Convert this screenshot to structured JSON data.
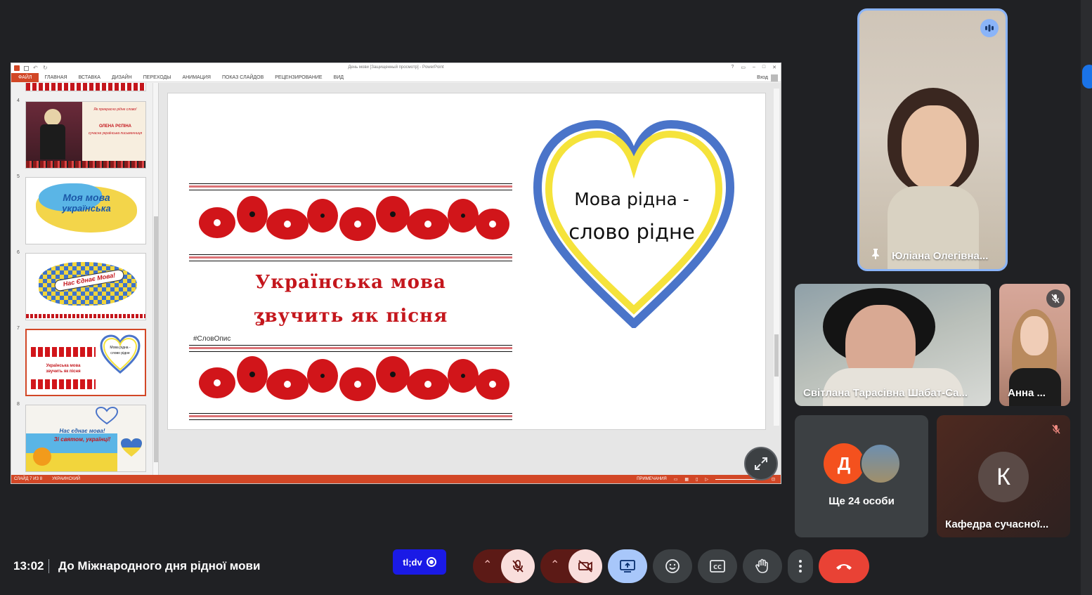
{
  "ppt": {
    "window_title": "День мови [Защищенный просмотр] - PowerPoint",
    "tabs": [
      "ФАЙЛ",
      "ГЛАВНАЯ",
      "ВСТАВКА",
      "ДИЗАЙН",
      "ПЕРЕХОДЫ",
      "АНИМАЦИЯ",
      "ПОКАЗ СЛАЙДОВ",
      "РЕЦЕНЗИРОВАНИЕ",
      "ВИД"
    ],
    "signin": "Вход",
    "thumbnails": [
      {
        "num": "4",
        "lines": [
          "Як прекрасно рідне слово!",
          "ОЛЕНА РЄПІНА",
          "сучасна українська письменниця"
        ]
      },
      {
        "num": "5",
        "lines": [
          "Моя мова",
          "українська"
        ]
      },
      {
        "num": "6",
        "lines": [
          "Нас Єднає Мова!"
        ]
      },
      {
        "num": "7",
        "lines": [
          "Мова рідна -",
          "слово рідне",
          "Українська мова",
          "звучить як пісня"
        ]
      },
      {
        "num": "8",
        "lines": [
          "Нас єднає мова!",
          "Зі святом, українці!"
        ]
      }
    ],
    "slide": {
      "title_line1": "Українська мова",
      "title_line2": "ʓвучить як пісня",
      "hashtag": "#СловОпис",
      "heart_line1": "Мова рідна -",
      "heart_line2": "слово рідне"
    },
    "status": {
      "slide_counter": "СЛАЙД 7 ИЗ 8",
      "language": "УКРАИНСКИЙ",
      "notes": "ПРИМЕЧАНИЯ"
    }
  },
  "participants": [
    {
      "name": "Юліана Олегівна...",
      "pinned": true,
      "speaking": true
    },
    {
      "name": "Світлана Тарасівна Шабат-Са..."
    },
    {
      "name": "Анна ...",
      "muted": true
    },
    {
      "name": "Ще 24 особи",
      "avatar_letter": "Д",
      "avatar_color": "#f4511e"
    },
    {
      "name": "Кафедра сучасної...",
      "avatar_letter": "К",
      "muted": true
    }
  ],
  "bottom": {
    "time": "13:02",
    "meeting_title": "До Міжнародного дня рідної мови",
    "tldv_label": "tl;dv"
  },
  "colors": {
    "accent_red": "#c4161c",
    "ppt_orange": "#d24726",
    "heart_blue": "#4a74c9",
    "heart_yellow": "#f5e33b",
    "speaking_border": "#8ab4f8",
    "hangup": "#e94235"
  }
}
